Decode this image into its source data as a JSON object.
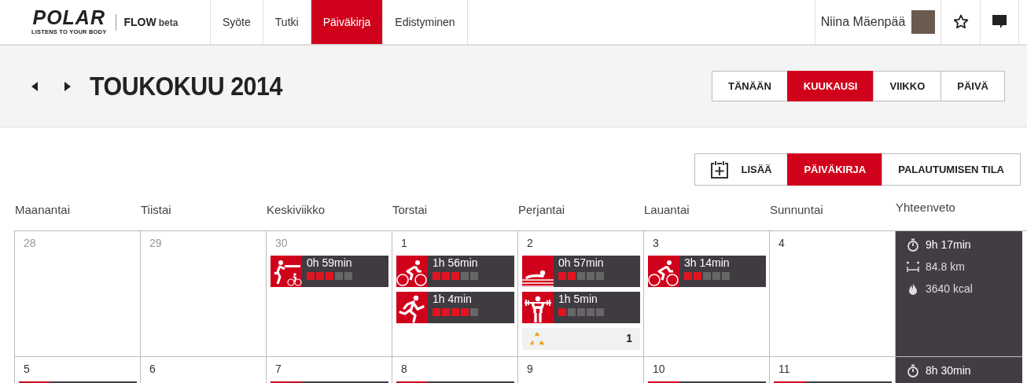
{
  "brand": {
    "logo": "POLAR",
    "tagline": "LISTENS TO YOUR BODY",
    "product": "FLOW",
    "badge": "beta"
  },
  "nav": [
    {
      "label": "Syöte",
      "selected": false
    },
    {
      "label": "Tutki",
      "selected": false
    },
    {
      "label": "Päiväkirja",
      "selected": true
    },
    {
      "label": "Edistyminen",
      "selected": false
    }
  ],
  "user": {
    "name": "Niina Mäenpää"
  },
  "title": "TOUKOKUU 2014",
  "views": [
    {
      "label": "TÄNÄÄN",
      "selected": false
    },
    {
      "label": "KUUKAUSI",
      "selected": true
    },
    {
      "label": "VIIKKO",
      "selected": false
    },
    {
      "label": "PÄIVÄ",
      "selected": false
    }
  ],
  "modes": [
    {
      "label": "LISÄÄ",
      "kind": "add",
      "selected": false
    },
    {
      "label": "PÄIVÄKIRJA",
      "kind": "mode",
      "selected": true
    },
    {
      "label": "PALAUTUMISEN TILA",
      "kind": "mode",
      "selected": false
    }
  ],
  "weekdays": [
    "Maanantai",
    "Tiistai",
    "Keskiviikko",
    "Torstai",
    "Perjantai",
    "Lauantai",
    "Sunnuntai"
  ],
  "summary_heading": "Yhteenveto",
  "weeks": [
    {
      "days": [
        {
          "date": "28",
          "other_month": true
        },
        {
          "date": "29",
          "other_month": true
        },
        {
          "date": "30",
          "other_month": true,
          "sessions": [
            {
              "kind": "triathlon",
              "duration": "0h 59min",
              "stars": 3
            }
          ]
        },
        {
          "date": "1",
          "other_month": false,
          "sessions": [
            {
              "kind": "cycling",
              "duration": "1h 56min",
              "stars": 3
            },
            {
              "kind": "running",
              "duration": "1h 4min",
              "stars": 4
            }
          ]
        },
        {
          "date": "2",
          "other_month": false,
          "sessions": [
            {
              "kind": "swimming",
              "duration": "0h 57min",
              "stars": 2
            },
            {
              "kind": "strength",
              "duration": "1h 5min",
              "stars": 1
            }
          ],
          "recovery": "1"
        },
        {
          "date": "3",
          "other_month": false,
          "sessions": [
            {
              "kind": "cycling",
              "duration": "3h 14min",
              "stars": 2
            }
          ]
        },
        {
          "date": "4",
          "other_month": false
        }
      ],
      "summary": [
        {
          "kind": "time",
          "value": "9h 17min"
        },
        {
          "kind": "distance",
          "value": "84.8 km"
        },
        {
          "kind": "calories",
          "value": "3640 kcal"
        }
      ]
    },
    {
      "days": [
        {
          "date": "5",
          "other_month": false,
          "sessions": [
            {
              "kind": "cut"
            }
          ]
        },
        {
          "date": "6",
          "other_month": false
        },
        {
          "date": "7",
          "other_month": false,
          "sessions": [
            {
              "kind": "cut"
            }
          ]
        },
        {
          "date": "8",
          "other_month": false,
          "sessions": [
            {
              "kind": "cut"
            }
          ]
        },
        {
          "date": "9",
          "other_month": false
        },
        {
          "date": "10",
          "other_month": false,
          "sessions": [
            {
              "kind": "cut"
            }
          ]
        },
        {
          "date": "11",
          "other_month": false,
          "sessions": [
            {
              "kind": "cut"
            }
          ]
        }
      ],
      "summary": [
        {
          "kind": "time",
          "value": "8h 30min"
        }
      ]
    }
  ]
}
